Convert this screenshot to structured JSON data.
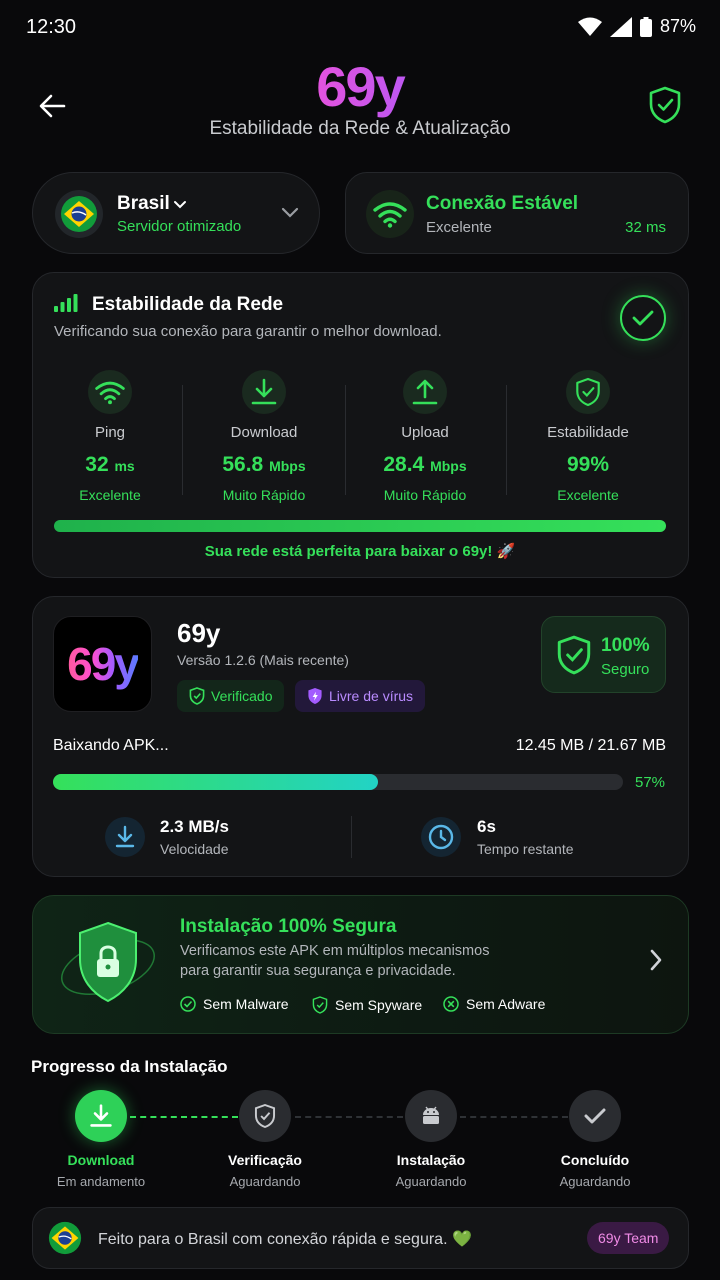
{
  "status": {
    "time": "12:30",
    "battery": "87%"
  },
  "header": {
    "logo": "69y",
    "subtitle": "Estabilidade da Rede & Atualização"
  },
  "server": {
    "country": "Brasil",
    "note": "Servidor otimizado"
  },
  "connection": {
    "title": "Conexão Estável",
    "quality": "Excelente",
    "latency": "32 ms"
  },
  "network": {
    "title": "Estabilidade da Rede",
    "subtitle": "Verificando sua conexão para garantir o melhor download.",
    "stats": [
      {
        "label": "Ping",
        "value": "32",
        "unit": "ms",
        "quality": "Excelente"
      },
      {
        "label": "Download",
        "value": "56.8",
        "unit": "Mbps",
        "quality": "Muito Rápido"
      },
      {
        "label": "Upload",
        "value": "28.4",
        "unit": "Mbps",
        "quality": "Muito Rápido"
      },
      {
        "label": "Estabilidade",
        "value": "99%",
        "unit": "",
        "quality": "Excelente"
      }
    ],
    "bar_progress": 1.0,
    "message": "Sua rede está perfeita para baixar o 69y! 🚀"
  },
  "app": {
    "icon_text": "69y",
    "name": "69y",
    "version": "Versão 1.2.6 (Mais recente)",
    "badge_verified": "Verificado",
    "badge_virus": "Livre de vírus",
    "safe_percent": "100%",
    "safe_label": "Seguro",
    "download_label": "Baixando APK...",
    "download_size": "12.45 MB / 21.67 MB",
    "progress": 0.57,
    "progress_text": "57%",
    "speed": "2.3 MB/s",
    "speed_label": "Velocidade",
    "remaining": "6s",
    "remaining_label": "Tempo restante"
  },
  "security": {
    "title": "Instalação 100% Segura",
    "line1": "Verificamos este APK em múltiplos mecanismos",
    "line2": "para garantir sua segurança e privacidade.",
    "checks": [
      "Sem Malware",
      "Sem Spyware",
      "Sem Adware"
    ]
  },
  "install": {
    "title": "Progresso da Instalação",
    "steps": [
      {
        "title": "Download",
        "status": "Em andamento"
      },
      {
        "title": "Verificação",
        "status": "Aguardando"
      },
      {
        "title": "Instalação",
        "status": "Aguardando"
      },
      {
        "title": "Concluído",
        "status": "Aguardando"
      }
    ]
  },
  "footer": {
    "text": "Feito para o Brasil com conexão rápida e segura. 💚",
    "team": "69y Team"
  },
  "colors": {
    "accent_green": "#35e05a",
    "progress_cyan": "#22d3c5",
    "purple": "#a35bff"
  }
}
